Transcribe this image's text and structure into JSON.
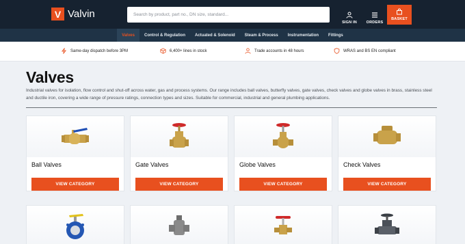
{
  "header": {
    "logo_letter": "V",
    "logo_text": "Valvin",
    "search_placeholder": "Search by product, part no., DN size, standard...",
    "signin_label": "SIGN IN",
    "orders_label": "ORDERS",
    "basket_label": "BASKET"
  },
  "nav": {
    "items": [
      "Valves",
      "Control & Regulation",
      "Actuated & Solenoid",
      "Steam & Process",
      "Instrumentation",
      "Fittings"
    ],
    "active": "Valves"
  },
  "usp": {
    "items": [
      {
        "text": "Same-day dispatch before 3PM",
        "icon": "lightning-icon"
      },
      {
        "text": "6,400+ lines in stock",
        "icon": "boxes-icon"
      },
      {
        "text": "Trade accounts in 48 hours",
        "icon": "user-icon"
      },
      {
        "text": "WRAS and BS EN compliant",
        "icon": "shield-icon"
      }
    ]
  },
  "main": {
    "title": "Valves",
    "intro": "Industrial valves for isolation, flow control and shut-off across water, gas and process systems. Our range includes ball valves, butterfly valves, gate valves, check valves and globe valves in brass, stainless steel and ductile iron, covering a wide range of pressure ratings, connection types and sizes. Suitable for commercial, industrial and general plumbing applications.",
    "button_label": "VIEW CATEGORY",
    "categories": [
      {
        "title": "Ball Valves",
        "image": "ball-valve"
      },
      {
        "title": "Gate Valves",
        "image": "gate-valve"
      },
      {
        "title": "Globe Valves",
        "image": "globe-valve"
      },
      {
        "title": "Check Valves",
        "image": "check-valve"
      },
      {
        "title": "",
        "image": "butterfly-valve"
      },
      {
        "title": "",
        "image": "plug-valve"
      },
      {
        "title": "",
        "image": "needle-valve"
      },
      {
        "title": "",
        "image": "diaphragm-valve"
      }
    ]
  },
  "colors": {
    "accent": "#e8501f",
    "header_bg": "#162230",
    "nav_bg": "#1f3346",
    "page_bg": "#eef1f5"
  }
}
